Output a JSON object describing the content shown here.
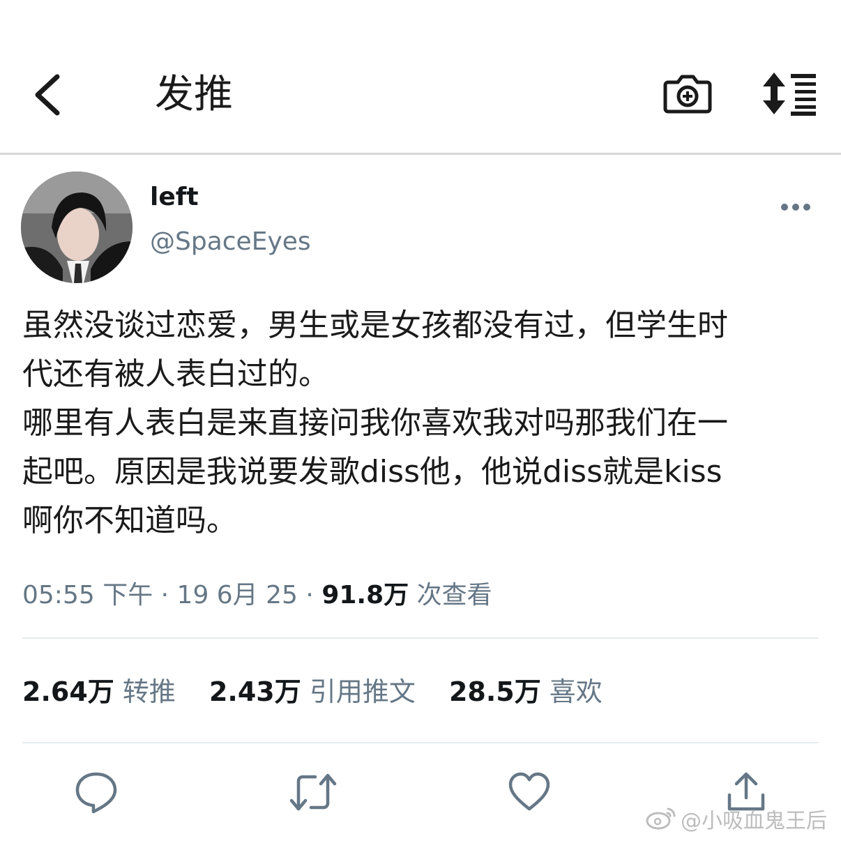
{
  "header": {
    "title": "发推",
    "back_icon": "back-chevron-icon",
    "camera_icon": "add-photo-camera-icon",
    "sort_icon": "sort-arrows-list-icon"
  },
  "tweet": {
    "display_name": "left",
    "handle": "@SpaceEyes",
    "more_icon": "more-dots-icon",
    "lines": [
      "虽然没谈过恋爱，男生或是女孩都没有过，但学生时",
      "代还有被人表白过的。",
      "哪里有人表白是来直接问我你喜欢我对吗那我们在一",
      "起吧。原因是我说要发歌diss他，他说diss就是kiss",
      "啊你不知道吗。"
    ],
    "meta": {
      "time": "05:55 下午",
      "date": "19 6月 25",
      "views_count": "91.8万",
      "views_label": "次查看"
    },
    "stats": {
      "retweets_count": "2.64万",
      "retweets_label": "转推",
      "quotes_count": "2.43万",
      "quotes_label": "引用推文",
      "likes_count": "28.5万",
      "likes_label": "喜欢"
    }
  },
  "actions": {
    "reply_icon": "reply-bubble-icon",
    "retweet_icon": "retweet-icon",
    "like_icon": "heart-icon",
    "share_icon": "share-upload-icon"
  },
  "watermark": {
    "text": "@小吸血鬼王后"
  }
}
